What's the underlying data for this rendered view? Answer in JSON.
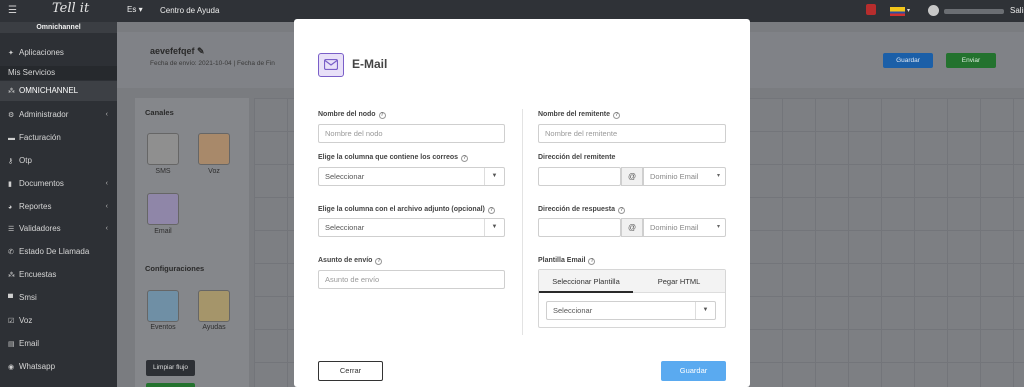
{
  "topbar": {
    "menu_icon": "hamburger-icon",
    "logo": "Tell it",
    "language": "Es",
    "help_link": "Centro de Ayuda",
    "exit_label": "Salir"
  },
  "sidebar": {
    "header": "Omnichannel",
    "items": [
      {
        "label": "Aplicaciones",
        "icon": "puzzle-icon"
      },
      {
        "label": "Mis Servicios",
        "icon": ""
      },
      {
        "label": "OMNICHANNEL",
        "icon": "sitemap-icon"
      },
      {
        "label": "Administrador",
        "icon": "gears-icon",
        "expandable": true
      },
      {
        "label": "Facturación",
        "icon": "card-icon"
      },
      {
        "label": "Otp",
        "icon": "key-icon"
      },
      {
        "label": "Documentos",
        "icon": "file-icon",
        "expandable": true
      },
      {
        "label": "Reportes",
        "icon": "pie-icon",
        "expandable": true
      },
      {
        "label": "Validadores",
        "icon": "list-icon",
        "expandable": true
      },
      {
        "label": "Estado De Llamada",
        "icon": "phone-icon"
      },
      {
        "label": "Encuestas",
        "icon": "network-icon"
      },
      {
        "label": "Smsi",
        "icon": "comment-icon"
      },
      {
        "label": "Voz",
        "icon": "check-square-icon"
      },
      {
        "label": "Email",
        "icon": "envelope-icon"
      },
      {
        "label": "Whatsapp",
        "icon": "comments-icon"
      }
    ]
  },
  "page": {
    "name": "aevefefqef",
    "meta": "Fecha de envío: 2021-10-04 | Fecha de Fin",
    "save_button": "Guardar",
    "send_button": "Enviar",
    "channels_title": "Canales",
    "channels": [
      "SMS",
      "Voz",
      "Email"
    ],
    "config_title": "Configuraciones",
    "configs": [
      "Eventos",
      "Ayudas"
    ],
    "clear_button": "Limpiar flujo"
  },
  "modal": {
    "title": "E-Mail",
    "node_name_label": "Nombre del nodo",
    "node_name_placeholder": "Nombre del nodo",
    "email_column_label": "Elige la columna que contiene los correos",
    "email_column_value": "Seleccionar",
    "attachment_column_label": "Elige la columna con el archivo adjunto (opcional)",
    "attachment_column_value": "Seleccionar",
    "subject_label": "Asunto de envío",
    "subject_placeholder": "Asunto de envío",
    "sender_name_label": "Nombre del remitente",
    "sender_name_placeholder": "Nombre del remitente",
    "sender_address_label": "Dirección del remitente",
    "sender_domain_value": "Dominio Email",
    "reply_label": "Dirección de respuesta",
    "reply_domain_value": "Dominio Email",
    "at_symbol": "@",
    "template_label": "Plantilla Email",
    "template_tabs": [
      "Seleccionar Plantilla",
      "Pegar HTML"
    ],
    "template_value": "Seleccionar",
    "close_button": "Cerrar",
    "save_button": "Guardar"
  },
  "colors": {
    "accent_blue": "#5aaaf0",
    "email_icon_purple": "#7a5fc8",
    "sidebar_bg": "#2d3035"
  }
}
